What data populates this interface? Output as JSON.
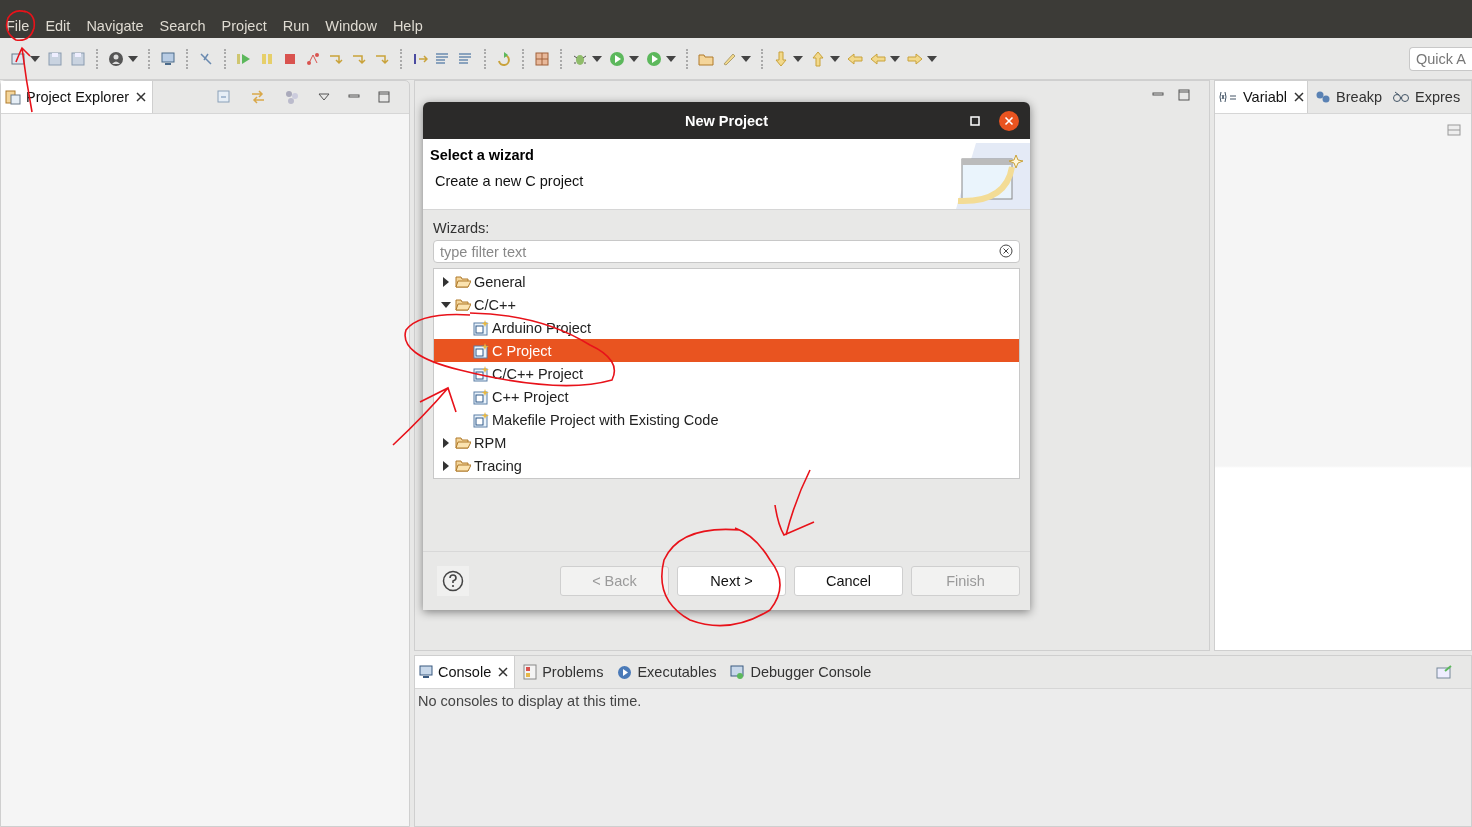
{
  "menu_bar": [
    {
      "label": "File"
    },
    {
      "label": "Edit"
    },
    {
      "label": "Navigate"
    },
    {
      "label": "Search"
    },
    {
      "label": "Project"
    },
    {
      "label": "Run"
    },
    {
      "label": "Window"
    },
    {
      "label": "Help"
    }
  ],
  "toolbar": {
    "quick_access": {
      "placeholder": "Quick A"
    }
  },
  "left_panel": {
    "tabs": [
      {
        "label": "Project Explorer",
        "selected": true
      }
    ]
  },
  "right_panel": {
    "tabs": [
      {
        "label": "Variabl",
        "selected": true
      },
      {
        "label": "Breakp",
        "selected": false
      },
      {
        "label": "Expres",
        "selected": false
      }
    ]
  },
  "bottom_panel": {
    "tabs": [
      {
        "label": "Console",
        "selected": true
      },
      {
        "label": "Problems",
        "selected": false
      },
      {
        "label": "Executables",
        "selected": false
      },
      {
        "label": "Debugger Console",
        "selected": false
      }
    ],
    "message": "No consoles to display at this time."
  },
  "dialog": {
    "title": "New Project",
    "heading": "Select a wizard",
    "description": "Create a new C project",
    "wizards_label": "Wizards:",
    "filter": {
      "placeholder": "type filter text"
    },
    "tree": [
      {
        "label": "General",
        "kind": "folder",
        "expanded": false,
        "selected": false
      },
      {
        "label": "C/C++",
        "kind": "folder",
        "expanded": true,
        "selected": false,
        "children": [
          {
            "label": "Arduino Project",
            "kind": "project",
            "selected": false
          },
          {
            "label": "C Project",
            "kind": "project",
            "selected": true
          },
          {
            "label": "C/C++ Project",
            "kind": "project",
            "selected": false
          },
          {
            "label": "C++ Project",
            "kind": "project",
            "selected": false
          },
          {
            "label": "Makefile Project with Existing Code",
            "kind": "project",
            "selected": false
          }
        ]
      },
      {
        "label": "RPM",
        "kind": "folder",
        "expanded": false,
        "selected": false
      },
      {
        "label": "Tracing",
        "kind": "folder",
        "expanded": false,
        "selected": false
      }
    ],
    "buttons": [
      {
        "label": "< Back",
        "disabled": true
      },
      {
        "label": "Next >",
        "disabled": false
      },
      {
        "label": "Cancel",
        "disabled": false
      },
      {
        "label": "Finish",
        "disabled": true
      }
    ]
  }
}
